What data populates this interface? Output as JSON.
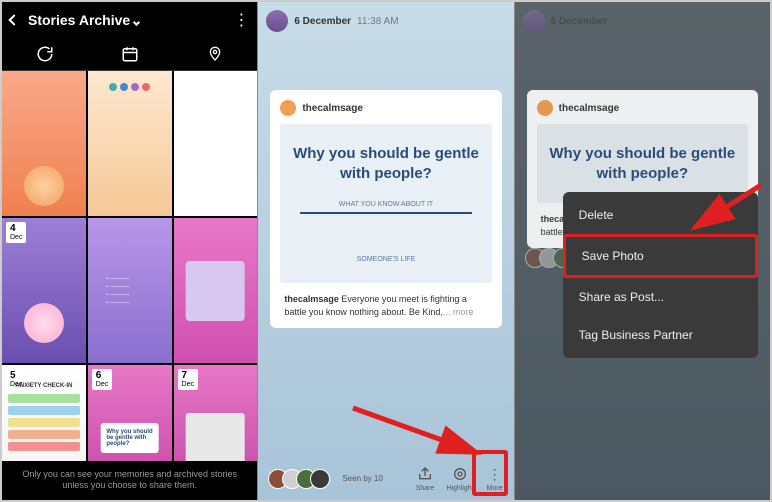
{
  "archive": {
    "title": "Stories Archive",
    "footer": "Only you can see your memories and archived stories unless you choose to share them.",
    "cells": [
      {
        "date": "",
        "mon": ""
      },
      {
        "date": "",
        "mon": ""
      },
      {
        "date": "",
        "mon": ""
      },
      {
        "date": "4",
        "mon": "Dec"
      },
      {
        "date": "",
        "mon": ""
      },
      {
        "date": "",
        "mon": ""
      },
      {
        "date": "5",
        "mon": "Dec"
      },
      {
        "date": "6",
        "mon": "Dec"
      },
      {
        "date": "7",
        "mon": "Dec"
      }
    ],
    "anxiety_title": "ANXIETY CHECK-IN",
    "gentle_card": "Why you should be gentle with people?"
  },
  "story": {
    "timestamp": "6 December",
    "time2": "11:38 AM",
    "username": "thecalmsage",
    "card_title": "Why you should be gentle with people?",
    "sub1": "WHAT YOU KNOW ABOUT IT",
    "sub2": "SOMEONE'S LIFE",
    "caption_user": "thecalmsage",
    "caption_text": " Everyone you meet is fighting a battle you know nothing about. Be Kind,",
    "more": "... more",
    "seen": "Seen by 10",
    "actions": {
      "share": "Share",
      "highlight": "Highlight",
      "more": "More"
    }
  },
  "menu": {
    "items": [
      "Delete",
      "Save Photo",
      "Share as Post...",
      "Tag Business Partner"
    ]
  }
}
